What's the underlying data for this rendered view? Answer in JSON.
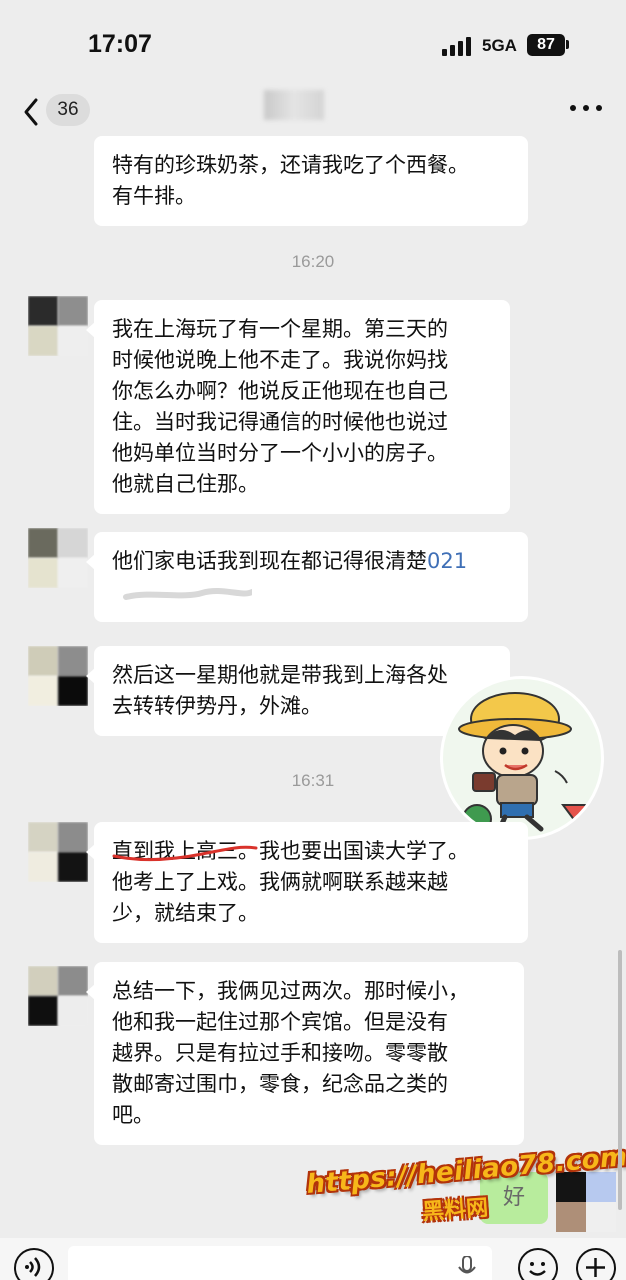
{
  "status": {
    "time": "17:07",
    "network": "5GA",
    "battery": "87"
  },
  "nav": {
    "unread_count": "36"
  },
  "messages": [
    {
      "lines": [
        "特有的珍珠奶茶，还请我吃了个西餐。",
        "有牛排。"
      ]
    },
    {
      "lines": [
        "我在上海玩了有一个星期。第三天的",
        "时候他说晚上他不走了。我说你妈找",
        "你怎么办啊？他说反正他现在也自己",
        "住。当时我记得通信的时候他也说过",
        "他妈单位当时分了一个小小的房子。",
        "他就自己住那。"
      ]
    },
    {
      "lines": [
        "他们家电话我到现在都记得很清楚"
      ],
      "number": "021"
    },
    {
      "lines": [
        "然后这一星期他就是带我到上海各处",
        "去转转伊势丹，外滩。"
      ]
    },
    {
      "lines": [
        "直到我上高三。我也要出国读大学了。",
        "他考上了上戏。我俩就啊联系越来越",
        "少，就结束了。"
      ]
    },
    {
      "lines": [
        "总结一下，我俩见过两次。那时候小，",
        "他和我一起住过那个宾馆。但是没有",
        "越界。只是有拉过手和接吻。零零散",
        "散邮寄过围巾，零食，纪念品之类的",
        "吧。"
      ]
    }
  ],
  "timestamps": [
    "16:20",
    "16:31"
  ],
  "sent_message": "好",
  "watermark": {
    "url": "https://heiliao78.com",
    "name": "黑料网"
  },
  "icons": [
    "back-arrow-icon",
    "more-icon",
    "voice-icon",
    "mic-icon",
    "emoji-icon",
    "plus-icon",
    "signal-icon",
    "battery-icon"
  ],
  "colors": {
    "background": "#ededed",
    "bubble": "#ffffff",
    "sent_bubble": "#95ec69",
    "link_number": "#3f6fb6",
    "underline": "#d9322b",
    "watermark": "#f7b71a"
  }
}
